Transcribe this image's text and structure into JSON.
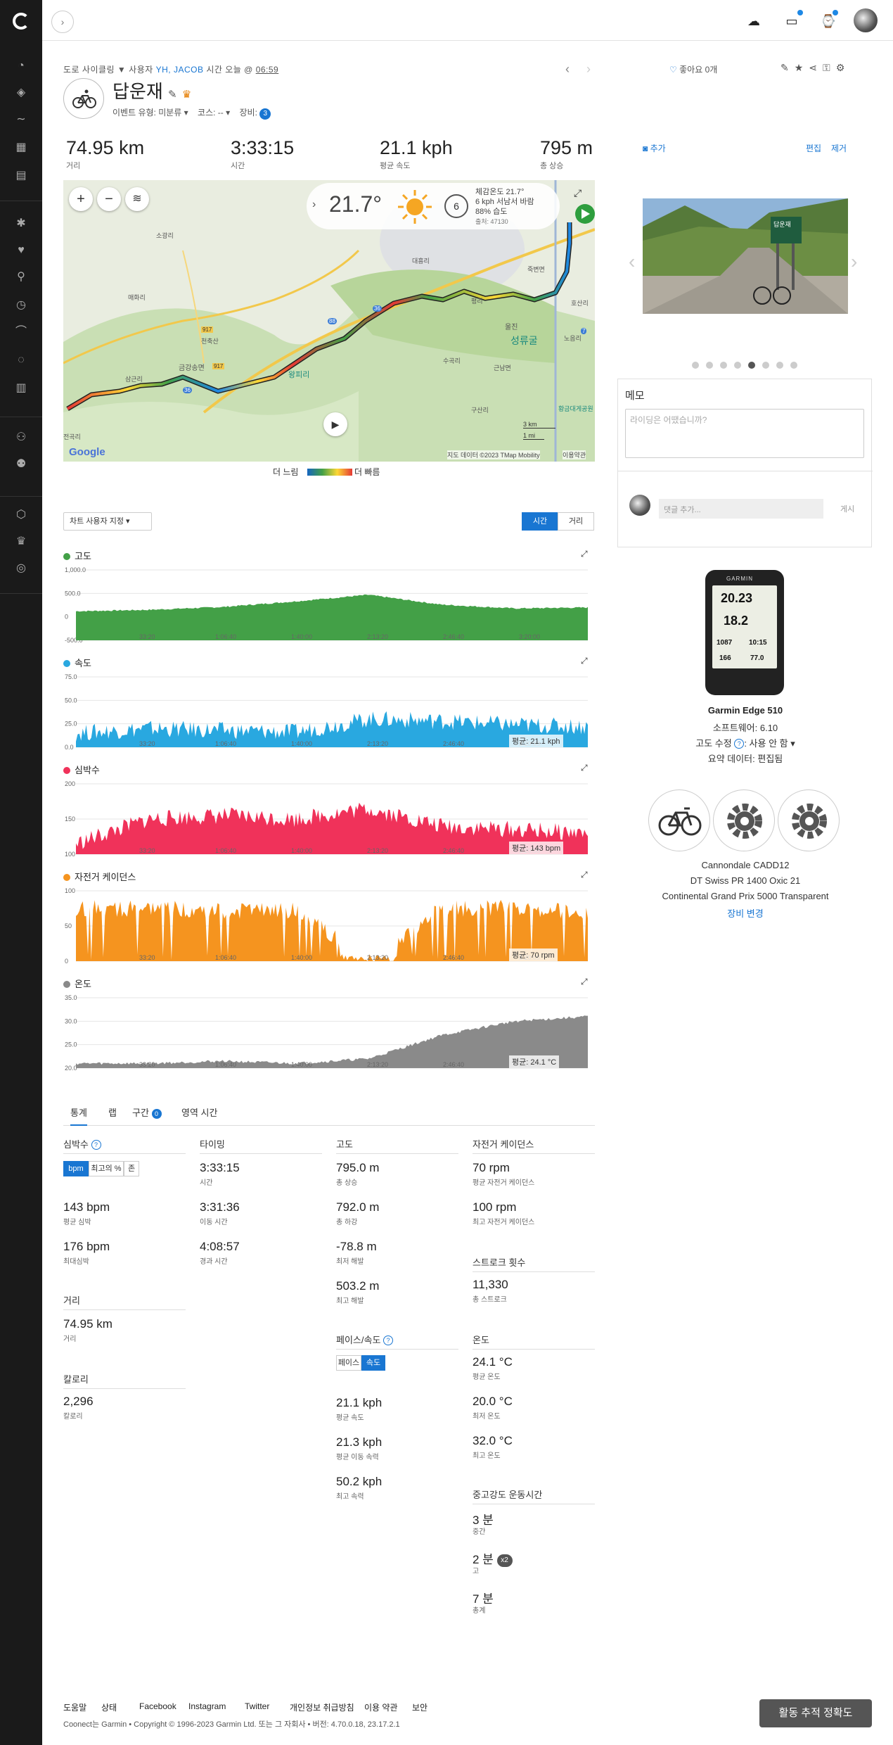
{
  "header": {
    "crumb_type": "도로 사이클링",
    "crumb_user_prefix": "사용자",
    "crumb_user": "YH, JACOB",
    "crumb_time_prefix": "시간 오늘 @",
    "crumb_time": "06:59",
    "title": "답운재",
    "event_type": "이벤트 유형: 미분류 ▾",
    "course": "코스: -- ▾",
    "gear_label": "장비:",
    "gear_count": "3",
    "like_text": "좋아요 0개"
  },
  "stats": [
    {
      "value": "74.95 km",
      "label": "거리"
    },
    {
      "value": "3:33:15",
      "label": "시간"
    },
    {
      "value": "21.1 kph",
      "label": "평균 속도"
    },
    {
      "value": "795 m",
      "label": "총 상승"
    }
  ],
  "map": {
    "temp": "21.7°",
    "wind_speed": "6",
    "weather_line1": "체감온도 21.7°",
    "weather_line2": "6 kph 서남서 바람",
    "weather_line3": "88% 습도",
    "weather_line4": "출처: 47130",
    "scale_km": "3 km",
    "scale_mi": "1 mi",
    "attribution": "지도 데이터 ©2023 TMap Mobility",
    "terms": "이용약관",
    "google": "Google",
    "places": [
      "소광리",
      "대흥리",
      "성류굴",
      "노음리",
      "호산리",
      "금강송면",
      "평리",
      "죽변면",
      "근남면",
      "구산리",
      "울진",
      "매화리",
      "수곡리",
      "삼근리",
      "왕피리",
      "전곡리",
      "황금대게공원",
      "천축산"
    ],
    "road_numbers": [
      "917",
      "917",
      "36",
      "36",
      "7",
      "88"
    ]
  },
  "speed_legend": {
    "slow": "더 느림",
    "fast": "더 빠름"
  },
  "chart_controls": {
    "custom": "차트 사용자 지정 ▾",
    "time": "시간",
    "distance": "거리"
  },
  "charts": [
    {
      "name": "고도",
      "color": "#43a047",
      "yticks": [
        "1,000.0",
        "500.0",
        "0",
        "-500.0"
      ],
      "avg": "",
      "xticks": [
        "33:20",
        "1:06:40",
        "1:40:00",
        "2:13:20",
        "2:46:40",
        "3:20:00"
      ]
    },
    {
      "name": "속도",
      "color": "#29a8e0",
      "yticks": [
        "75.0",
        "50.0",
        "25.0",
        "0.0"
      ],
      "avg": "평균: 21.1 kph",
      "xticks": [
        "33:20",
        "1:06:40",
        "1:40:00",
        "2:13:20",
        "2:46:40",
        "3:20:00"
      ]
    },
    {
      "name": "심박수",
      "color": "#f0325a",
      "yticks": [
        "200",
        "150",
        "100"
      ],
      "avg": "평균: 143 bpm",
      "xticks": [
        "33:20",
        "1:06:40",
        "1:40:00",
        "2:13:20",
        "2:46:40",
        "3:20:00"
      ]
    },
    {
      "name": "자전거 케이던스",
      "color": "#f5941f",
      "yticks": [
        "100",
        "50",
        "0"
      ],
      "avg": "평균: 70 rpm",
      "xticks": [
        "33:20",
        "1:06:40",
        "1:40:00",
        "2:13:20",
        "2:46:40",
        "3:20:00"
      ]
    },
    {
      "name": "온도",
      "color": "#8a8a8a",
      "yticks": [
        "35.0",
        "30.0",
        "25.0",
        "20.0"
      ],
      "avg": "평균: 24.1 °C",
      "xticks": [
        "33:20",
        "1:06:40",
        "1:40:00",
        "2:13:20",
        "2:46:40",
        "3:20:00"
      ]
    }
  ],
  "chart_data": [
    {
      "type": "area",
      "title": "고도",
      "x": [
        "0:00",
        "33:20",
        "1:06:40",
        "1:40:00",
        "2:13:20",
        "2:46:40",
        "3:20:00",
        "3:33:15"
      ],
      "series": [
        {
          "values": [
            120,
            150,
            210,
            330,
            470,
            260,
            180,
            200
          ]
        }
      ],
      "ylim": [
        -500,
        1000
      ]
    },
    {
      "type": "area",
      "title": "속도",
      "x": [
        "0:00",
        "33:20",
        "1:06:40",
        "1:40:00",
        "2:13:20",
        "2:46:40",
        "3:20:00",
        "3:33:15"
      ],
      "series": [
        {
          "values": [
            15,
            20,
            18,
            16,
            30,
            28,
            24,
            22
          ]
        }
      ],
      "ylim": [
        0,
        75
      ]
    },
    {
      "type": "area",
      "title": "심박수",
      "x": [
        "0:00",
        "33:20",
        "1:06:40",
        "1:40:00",
        "2:13:20",
        "2:46:40",
        "3:20:00",
        "3:33:15"
      ],
      "series": [
        {
          "values": [
            115,
            150,
            155,
            150,
            165,
            140,
            135,
            130
          ]
        }
      ],
      "ylim": [
        100,
        200
      ]
    },
    {
      "type": "bar",
      "title": "자전거 케이던스",
      "x": [
        "0:00",
        "33:20",
        "1:06:40",
        "1:40:00",
        "2:13:20",
        "2:46:40",
        "3:20:00",
        "3:33:15"
      ],
      "series": [
        {
          "values": [
            75,
            75,
            72,
            72,
            0,
            75,
            75,
            70
          ]
        }
      ],
      "ylim": [
        0,
        100
      ]
    },
    {
      "type": "area",
      "title": "온도",
      "x": [
        "0:00",
        "33:20",
        "1:06:40",
        "1:40:00",
        "2:13:20",
        "2:46:40",
        "3:20:00",
        "3:33:15"
      ],
      "series": [
        {
          "values": [
            21,
            21,
            21.5,
            21,
            22,
            27,
            30,
            31
          ]
        }
      ],
      "ylim": [
        20,
        35
      ]
    }
  ],
  "tabs": [
    "통계",
    "랩",
    "구간",
    "영역 시간"
  ],
  "segment_count": "0",
  "stats_detail": {
    "hr": {
      "title": "심박수",
      "toggle": [
        "bpm",
        "최고의 %",
        "존"
      ],
      "avg": "143 bpm",
      "avg_l": "평균 심박",
      "max": "176 bpm",
      "max_l": "최대심박"
    },
    "distance": {
      "title": "거리",
      "v": "74.95 km",
      "l": "거리"
    },
    "calories": {
      "title": "칼로리",
      "v": "2,296",
      "l": "칼로리"
    },
    "timing": {
      "title": "타이밍",
      "t1": "3:33:15",
      "l1": "시간",
      "t2": "3:31:36",
      "l2": "이동 시간",
      "t3": "4:08:57",
      "l3": "경과 시간"
    },
    "elevation": {
      "title": "고도",
      "v1": "795.0 m",
      "l1": "총 상승",
      "v2": "792.0 m",
      "l2": "총 하강",
      "v3": "-78.8 m",
      "l3": "최저 해발",
      "v4": "503.2 m",
      "l4": "최고 해발"
    },
    "pace": {
      "title": "페이스/속도",
      "toggle": [
        "페이스",
        "속도"
      ],
      "v1": "21.1 kph",
      "l1": "평균 속도",
      "v2": "21.3 kph",
      "l2": "평균 이동 속력",
      "v3": "50.2 kph",
      "l3": "최고 속력"
    },
    "cadence": {
      "title": "자전거 케이던스",
      "v1": "70 rpm",
      "l1": "평균 자전거 케이던스",
      "v2": "100 rpm",
      "l2": "최고 자전거 케이던스"
    },
    "strokes": {
      "title": "스트로크 횟수",
      "v": "11,330",
      "l": "총 스트로크"
    },
    "temp": {
      "title": "온도",
      "v1": "24.1 °C",
      "l1": "평균 온도",
      "v2": "20.0 °C",
      "l2": "최저 온도",
      "v3": "32.0 °C",
      "l3": "최고 온도"
    },
    "intensity": {
      "title": "중고강도 운동시간",
      "v1": "3 분",
      "l1": "중간",
      "v2": "2 분",
      "badge": "x2",
      "l2": "고",
      "v3": "7 분",
      "l3": "총계"
    }
  },
  "right": {
    "add": "추가",
    "edit": "편집",
    "remove": "제거",
    "memo_title": "메모",
    "memo_placeholder": "라이딩은 어땠습니까?",
    "comment_placeholder": "댓글 추가...",
    "post": "게시",
    "device_screen": {
      "brand": "GARMIN",
      "v1": "20.23",
      "v2": "18.2",
      "v3": "1087",
      "v4": "10:15",
      "v5": "166",
      "v6": "77.0"
    },
    "device_name": "Garmin Edge 510",
    "software": "소프트웨어: 6.10",
    "elev_corr_label": "고도 수정",
    "elev_corr_value": ": 사용 안 함 ▾",
    "summary": "요약 데이터: 편집됨",
    "gear1": "Cannondale CADD12",
    "gear2": "DT Swiss PR 1400 Oxic 21",
    "gear3": "Continental Grand Prix 5000 Transparent",
    "gear_change": "장비 변경",
    "photo_sign": "답운재",
    "dots_total": 8,
    "dots_active": 5
  },
  "footer": {
    "links": [
      "도움말",
      "상태",
      "Facebook",
      "Instagram",
      "Twitter",
      "개인정보 취급방침",
      "이용 약관",
      "보안"
    ],
    "copyright": "Coonect는 Garmin • Copyright © 1996-2023 Garmin Ltd. 또는 그 자회사 • 버전: 4.70.0.18, 23.17.2.1",
    "tracking": "활동 추적 정확도"
  }
}
